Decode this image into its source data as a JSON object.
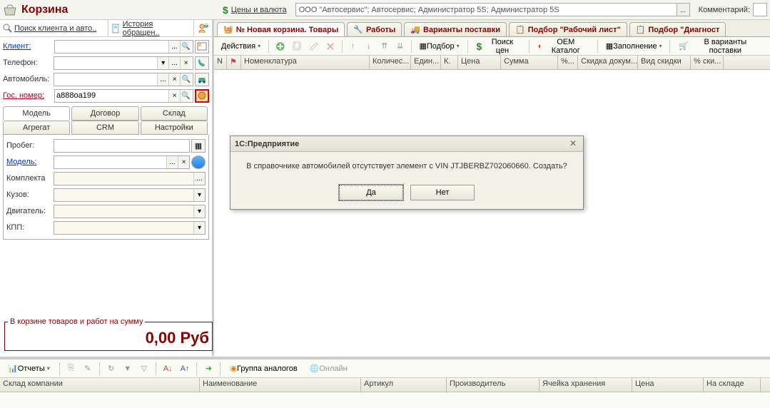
{
  "header": {
    "title": "Корзина",
    "prices_currency": "Цены и валюта",
    "org_value": "ООО \"Автосервис\"; Автосервис; Администратор 5S; Администратор 5S",
    "comment_label": "Комментарий:"
  },
  "left": {
    "search_client": "Поиск клиента и авто..",
    "history": "История обращен..",
    "labels": {
      "client": "Клиент:",
      "phone": "Телефон:",
      "auto": "Автомобиль:",
      "gosnomer": "Гос. номер:"
    },
    "gosnomer_value": "а888оа199",
    "tabs_row1": [
      "Модель",
      "Договор",
      "Склад"
    ],
    "tabs_row2": [
      "Агрегат",
      "CRM",
      "Настройки"
    ],
    "model": {
      "probeg": "Пробег:",
      "model": "Модель:",
      "komplekta": "Комплекта",
      "kuzov": "Кузов:",
      "dvigatel": "Двигатель:",
      "kpp": "КПП:"
    },
    "basket_sum_label": "В корзине товаров и работ на сумму",
    "basket_sum_value": "0,00 Руб"
  },
  "doc_tabs": [
    "№ Новая корзина. Товары",
    "Работы",
    "Варианты поставки",
    "Подбор \"Рабочий лист\"",
    "Подбор \"Диагност"
  ],
  "toolbar": {
    "actions": "Действия",
    "podbor": "Подбор",
    "poisk_cen": "Поиск цен",
    "oem": "OEM Каталог",
    "zapolnenie": "Заполнение",
    "varianty": "В варианты поставки"
  },
  "grid_cols": [
    "N",
    "",
    "Номенклатура",
    "Количес...",
    "Един...",
    "К.",
    "Цена",
    "Сумма",
    "%...",
    "Скидка докум...",
    "Вид скидки",
    "% ски..."
  ],
  "dialog": {
    "title": "1С:Предприятие",
    "message": "В справочнике автомобилей отсутствует элемент с VIN JTJBERBZ702060660. Создать?",
    "yes": "Да",
    "no": "Нет"
  },
  "bottom": {
    "reports": "Отчеты",
    "group_analogs": "Группа аналогов",
    "online": "Онлайн",
    "cols": [
      "Склад компании",
      "Наименование",
      "Артикул",
      "Производитель",
      "Ячейка хранения",
      "Цена",
      "На складе"
    ]
  }
}
